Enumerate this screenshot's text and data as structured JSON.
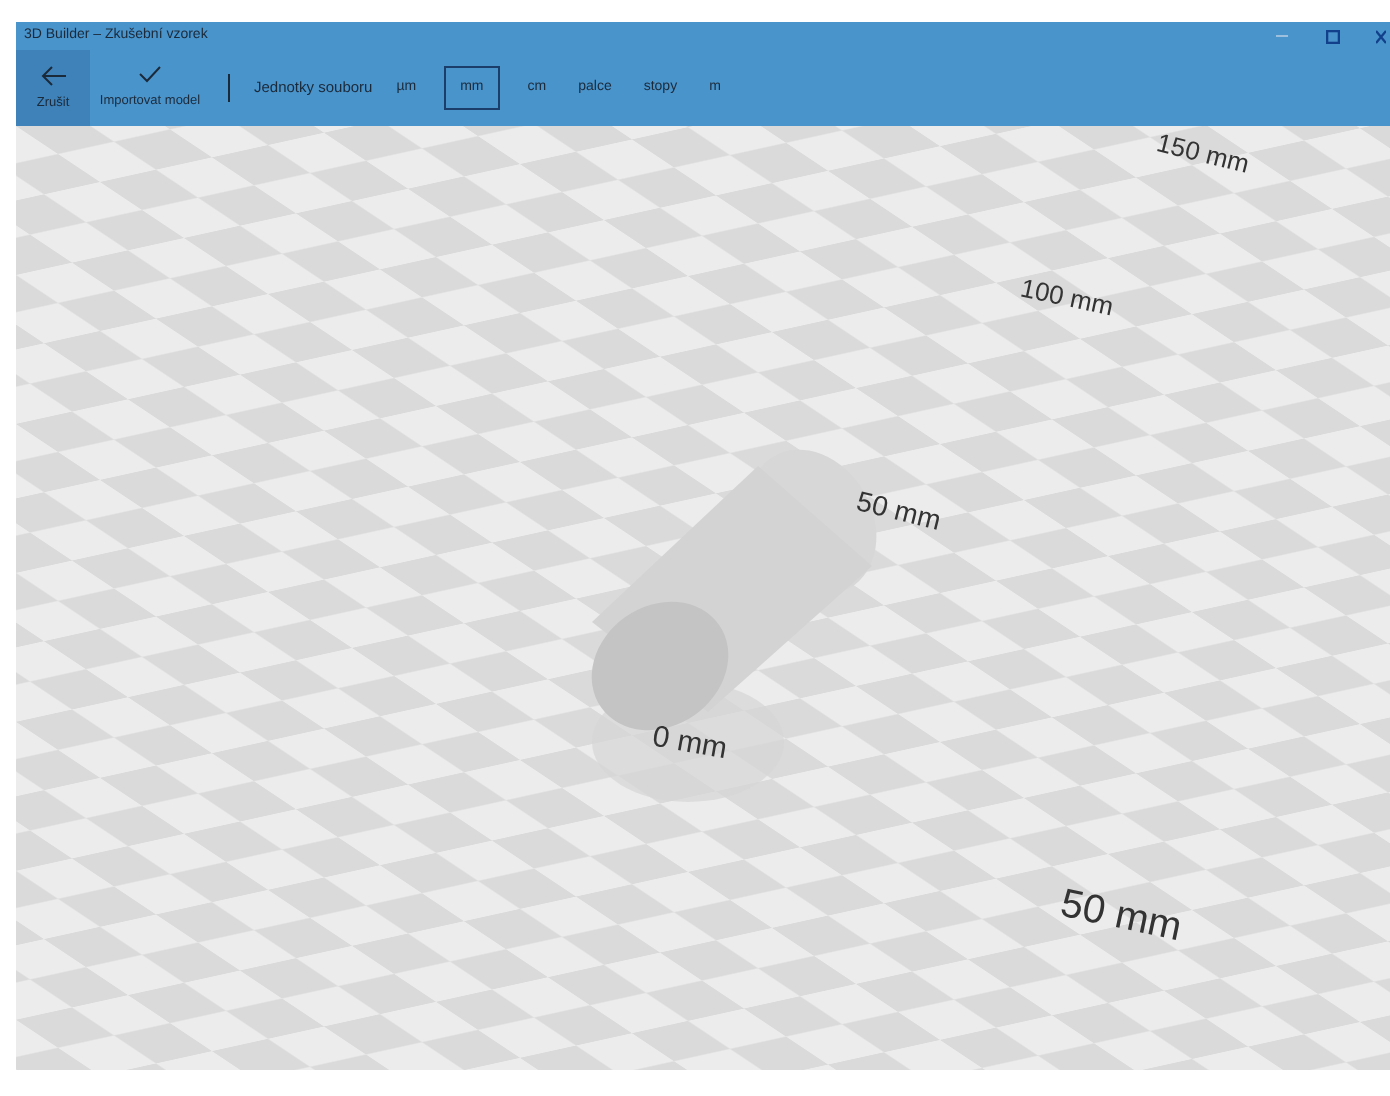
{
  "window": {
    "title": "3D Builder – Zkušební vzorek"
  },
  "toolbar": {
    "back": {
      "label": "Zrušit"
    },
    "import": {
      "label": "Importovat model"
    },
    "units_label": "Jednotky souboru",
    "units": [
      {
        "label": "µm",
        "selected": false
      },
      {
        "label": "mm",
        "selected": true
      },
      {
        "label": "cm",
        "selected": false
      },
      {
        "label": "palce",
        "selected": false
      },
      {
        "label": "stopy",
        "selected": false
      },
      {
        "label": "m",
        "selected": false
      }
    ]
  },
  "scene": {
    "labels": [
      "150 mm",
      "100 mm",
      "50 mm",
      "0 mm",
      "50 mm"
    ]
  }
}
